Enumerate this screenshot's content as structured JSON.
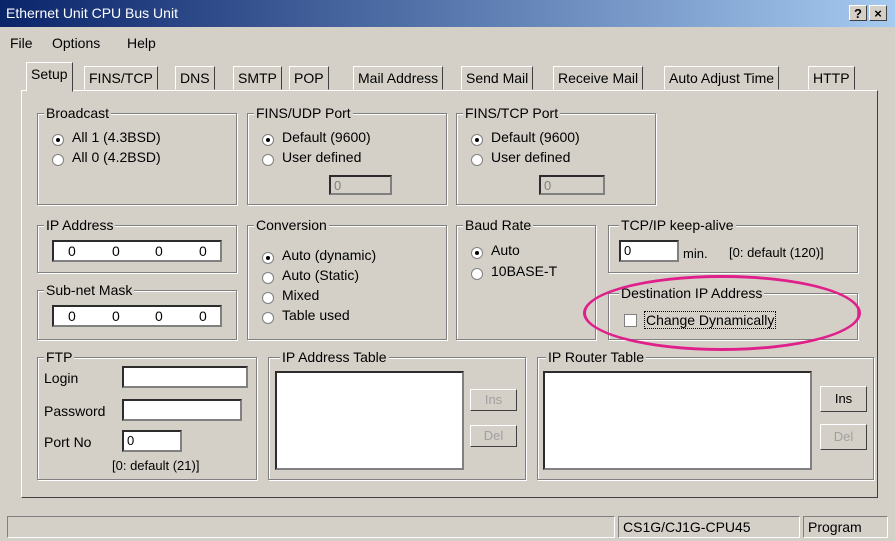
{
  "window": {
    "title": "Ethernet Unit CPU Bus Unit",
    "help_btn": "?",
    "close_btn": "×"
  },
  "menu": [
    "File",
    "Options",
    "Help"
  ],
  "tabs": [
    "Setup",
    "FINS/TCP",
    "DNS",
    "SMTP",
    "POP",
    "Mail Address",
    "Send Mail",
    "Receive Mail",
    "Auto Adjust Time",
    "HTTP"
  ],
  "broadcast": {
    "label": "Broadcast",
    "options": [
      "All 1 (4.3BSD)",
      "All 0 (4.2BSD)"
    ],
    "selected": 0
  },
  "fins_udp": {
    "label": "FINS/UDP Port",
    "options": [
      "Default (9600)",
      "User defined"
    ],
    "selected": 0,
    "value": "0"
  },
  "fins_tcp": {
    "label": "FINS/TCP Port",
    "options": [
      "Default (9600)",
      "User defined"
    ],
    "selected": 0,
    "value": "0"
  },
  "ip_address": {
    "label": "IP Address",
    "octets": [
      "0",
      "0",
      "0",
      "0"
    ]
  },
  "subnet": {
    "label": "Sub-net Mask",
    "octets": [
      "0",
      "0",
      "0",
      "0"
    ]
  },
  "conversion": {
    "label": "Conversion",
    "options": [
      "Auto (dynamic)",
      "Auto (Static)",
      "Mixed",
      "Table used"
    ],
    "selected": 0
  },
  "baud": {
    "label": "Baud Rate",
    "options": [
      "Auto",
      "10BASE-T"
    ],
    "selected": 0
  },
  "keepalive": {
    "label": "TCP/IP keep-alive",
    "value": "0",
    "unit": "min.",
    "hint": "[0: default (120)]"
  },
  "dest_ip": {
    "label": "Destination IP Address",
    "checkbox_label": "Change Dynamically",
    "checked": false
  },
  "ftp": {
    "label": "FTP",
    "login_label": "Login",
    "login_value": "",
    "password_label": "Password",
    "password_value": "",
    "port_label": "Port No",
    "port_value": "0",
    "hint": "[0: default (21)]"
  },
  "ip_table": {
    "label": "IP Address Table",
    "ins": "Ins",
    "del": "Del"
  },
  "router_table": {
    "label": "IP Router Table",
    "ins": "Ins",
    "del": "Del"
  },
  "statusbar": {
    "model": "CS1G/CJ1G-CPU45",
    "mode": "Program"
  },
  "colors": {
    "titlebar_start": "#0a246a",
    "titlebar_end": "#a6caf0",
    "face": "#d4d0c8",
    "highlight_ellipse": "#e0208a"
  }
}
